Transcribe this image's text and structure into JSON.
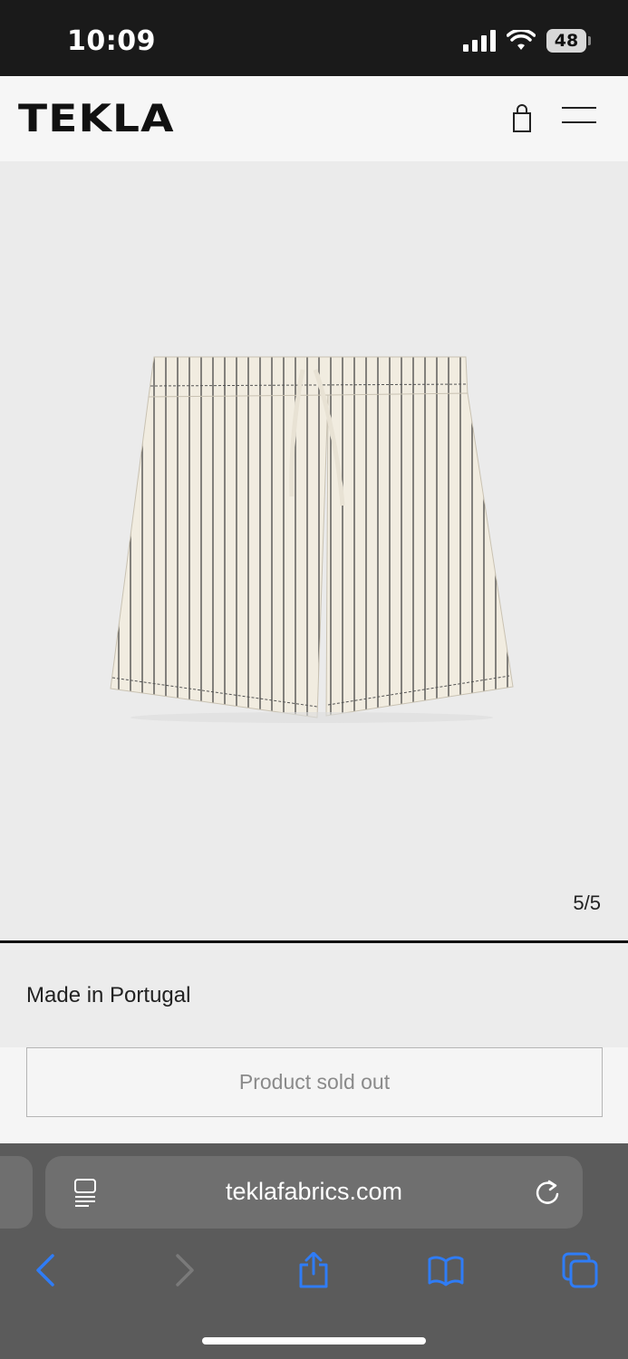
{
  "status_bar": {
    "time": "10:09",
    "battery": "48",
    "icons": [
      "signal-icon",
      "wifi-icon",
      "battery-icon"
    ]
  },
  "header": {
    "logo": "TEKLA",
    "icons": [
      "bag-icon",
      "hamburger-menu-icon"
    ]
  },
  "gallery": {
    "counter": "5/5",
    "image": "striped-shorts-product-image",
    "current_index": 5,
    "total": 5
  },
  "product": {
    "made_in": "Made in Portugal",
    "cta_label": "Product sold out",
    "cta_disabled": true
  },
  "browser": {
    "url": "teklafabrics.com",
    "toolbar": [
      "back-icon",
      "forward-icon",
      "share-icon",
      "bookmarks-icon",
      "tabs-icon"
    ]
  },
  "colors": {
    "accent": "#2f7cf6",
    "status_bar": "#1a1a1a",
    "browser_chrome": "#5b5b5b"
  }
}
